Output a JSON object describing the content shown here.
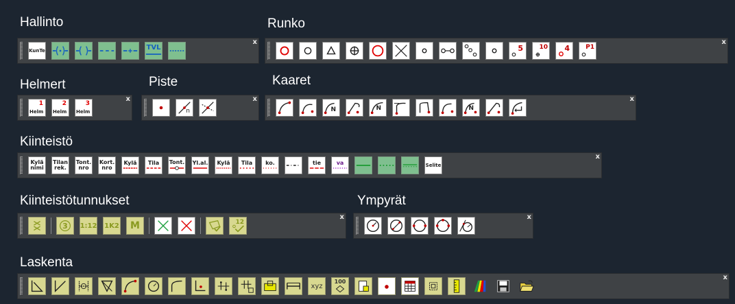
{
  "groups": {
    "hallinto": {
      "title": "Hallinto",
      "kunta_label": "KunTe",
      "tvl_label": "TVL"
    },
    "runko": {
      "title": "Runko",
      "labels": [
        "5",
        "10",
        "4",
        "P1"
      ]
    },
    "helmert": {
      "title": "Helmert",
      "buttons": [
        {
          "num": "1",
          "label": "Helm"
        },
        {
          "num": "2",
          "label": "Helm"
        },
        {
          "num": "3",
          "label": "Helm"
        }
      ]
    },
    "piste": {
      "title": "Piste",
      "n_label": "n"
    },
    "kaaret": {
      "title": "Kaaret",
      "n_label": "N"
    },
    "kiinteisto": {
      "title": "Kiinteistö",
      "buttons": [
        {
          "l1": "Kylä",
          "l2": "nimi"
        },
        {
          "l1": "Tilan",
          "l2": "rek."
        },
        {
          "l1": "Tont.",
          "l2": "nro"
        },
        {
          "l1": "Kort.",
          "l2": "nro"
        },
        {
          "l1": "Kylä",
          "l2": ""
        },
        {
          "l1": "Tila",
          "l2": ""
        },
        {
          "l1": "Tont.",
          "l2": ""
        },
        {
          "l1": "Yl.al.",
          "l2": ""
        },
        {
          "l1": "Kylä",
          "l2": ""
        },
        {
          "l1": "Tila",
          "l2": ""
        },
        {
          "l1": "ko.",
          "l2": ""
        },
        {
          "l1": "",
          "l2": ""
        },
        {
          "l1": "tie",
          "l2": ""
        },
        {
          "l1": "va",
          "l2": ""
        },
        {
          "l1": "",
          "l2": ""
        },
        {
          "l1": "",
          "l2": ""
        },
        {
          "l1": "",
          "l2": ""
        },
        {
          "l1": "Selite",
          "l2": ""
        }
      ]
    },
    "kiinteistotunnukset": {
      "title": "Kiinteistötunnukset",
      "labels": [
        "3",
        "1:12",
        "1K2",
        "M",
        "12"
      ]
    },
    "ympyrat": {
      "title": "Ympyrät"
    },
    "laskenta": {
      "title": "Laskenta",
      "xyz_label": "xyz",
      "hundred_label": "100"
    }
  },
  "close_glyph": "x",
  "colors": {
    "background": "#1c2530",
    "toolbar": "#3f4245",
    "red": "#e00000",
    "green": "#7fbf8f",
    "yellow": "#d8d890"
  }
}
